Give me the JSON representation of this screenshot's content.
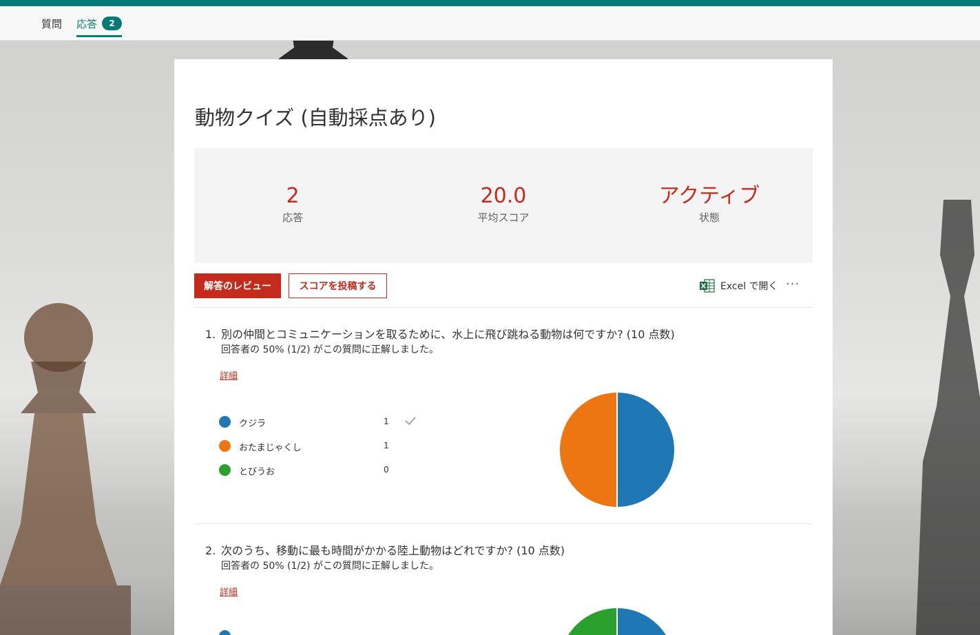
{
  "nav": {
    "tabs": [
      {
        "label": "質問"
      },
      {
        "label": "応答",
        "badge": "2"
      }
    ]
  },
  "form": {
    "title": "動物クイズ (自動採点あり)",
    "stats": [
      {
        "value": "2",
        "label": "応答"
      },
      {
        "value": "20.0",
        "label": "平均スコア"
      },
      {
        "value": "アクティブ",
        "label": "状態"
      }
    ],
    "actions": {
      "review_label": "解答のレビュー",
      "post_label": "スコアを投稿する",
      "excel_label": "Excel で開く",
      "more_label": "···"
    }
  },
  "colors": {
    "accent_teal": "#077a78",
    "accent_red": "#c42b1c",
    "series_blue": "#1f77b4",
    "series_orange": "#ed7512",
    "series_green": "#2ca02c"
  },
  "questions": [
    {
      "number": "1.",
      "title": "別の仲間とコミュニケーションを取るために、水上に飛び跳ねる動物は何ですか? (10 点数)",
      "summary": "回答者の 50% (1/2) がこの質問に正解しました。",
      "details_label": "詳細",
      "options": [
        {
          "label": "クジラ",
          "count": "1",
          "correct": true
        },
        {
          "label": "おたまじゃくし",
          "count": "1",
          "correct": false
        },
        {
          "label": "とびうお",
          "count": "0",
          "correct": false
        }
      ]
    },
    {
      "number": "2.",
      "title": "次のうち、移動に最も時間がかかる陸上動物はどれですか? (10 点数)",
      "summary": "回答者の 50% (1/2) がこの質問に正解しました。",
      "details_label": "詳細"
    }
  ],
  "chart_data": [
    {
      "type": "pie",
      "categories": [
        "クジラ",
        "おたまじゃくし",
        "とびうお"
      ],
      "values": [
        1,
        1,
        0
      ]
    }
  ]
}
